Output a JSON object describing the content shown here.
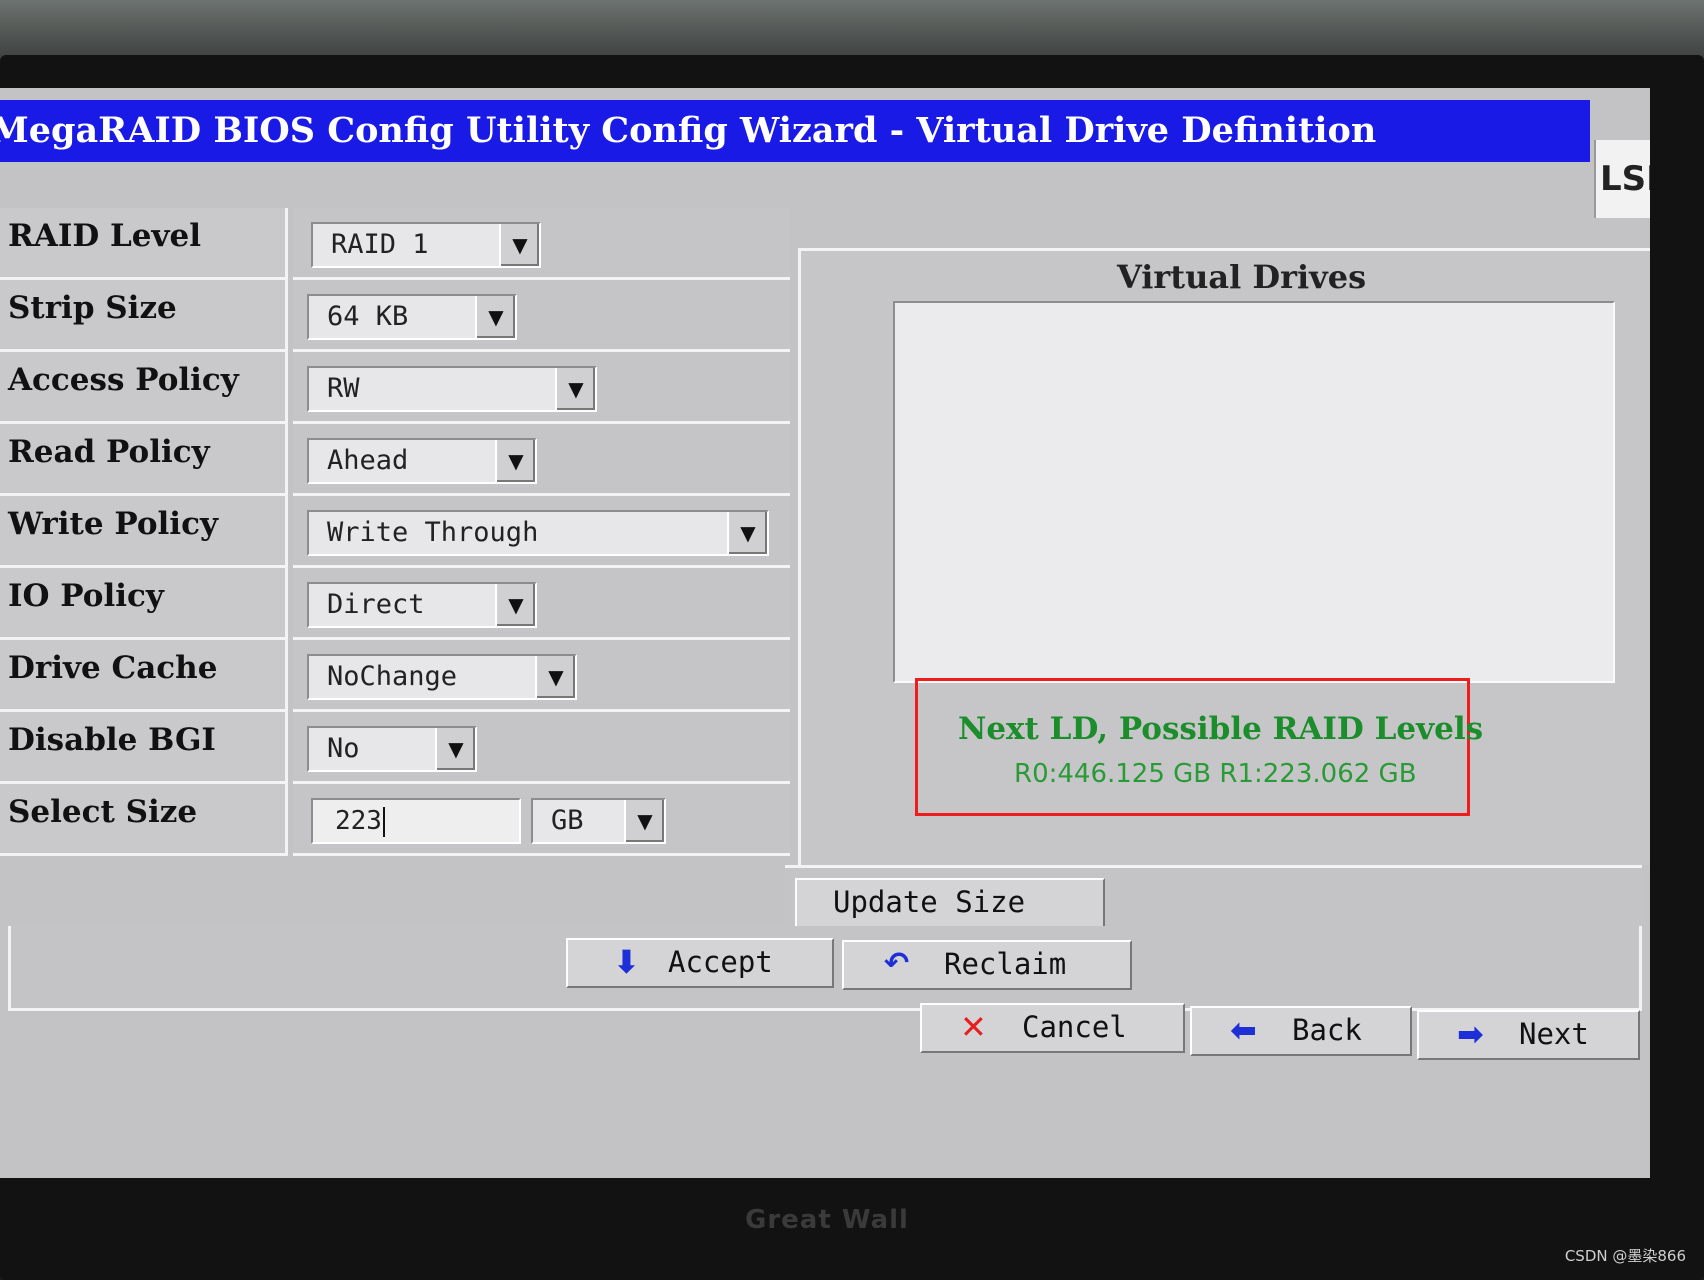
{
  "window": {
    "title": "MegaRAID BIOS Config Utility  Config Wizard - Virtual Drive Definition",
    "logo": "LSI"
  },
  "form": {
    "rows": [
      {
        "label": "RAID Level",
        "value": "RAID 1"
      },
      {
        "label": "Strip Size",
        "value": "64 KB"
      },
      {
        "label": "Access Policy",
        "value": "RW"
      },
      {
        "label": "Read Policy",
        "value": "Ahead"
      },
      {
        "label": "Write Policy",
        "value": "Write Through"
      },
      {
        "label": "IO Policy",
        "value": "Direct"
      },
      {
        "label": "Drive Cache",
        "value": "NoChange"
      },
      {
        "label": "Disable BGI",
        "value": "No"
      },
      {
        "label": "Select Size",
        "value": "223",
        "unit": "GB"
      }
    ]
  },
  "virtual_drives": {
    "title": "Virtual Drives",
    "next_ld_title": "Next LD, Possible RAID Levels",
    "next_ld_values": "R0:446.125 GB  R1:223.062 GB"
  },
  "buttons": {
    "update_size": "Update Size",
    "accept": "Accept",
    "reclaim": "Reclaim",
    "cancel": "Cancel",
    "back": "Back",
    "next": "Next"
  },
  "monitor": {
    "brand": "Great Wall"
  },
  "watermark": "CSDN @墨染866",
  "colors": {
    "title_bar": "#1a1ae6",
    "highlight_border": "#ee1c1c",
    "next_ld_text": "#1b8d2a",
    "screen_bg": "#c3c3c6"
  }
}
